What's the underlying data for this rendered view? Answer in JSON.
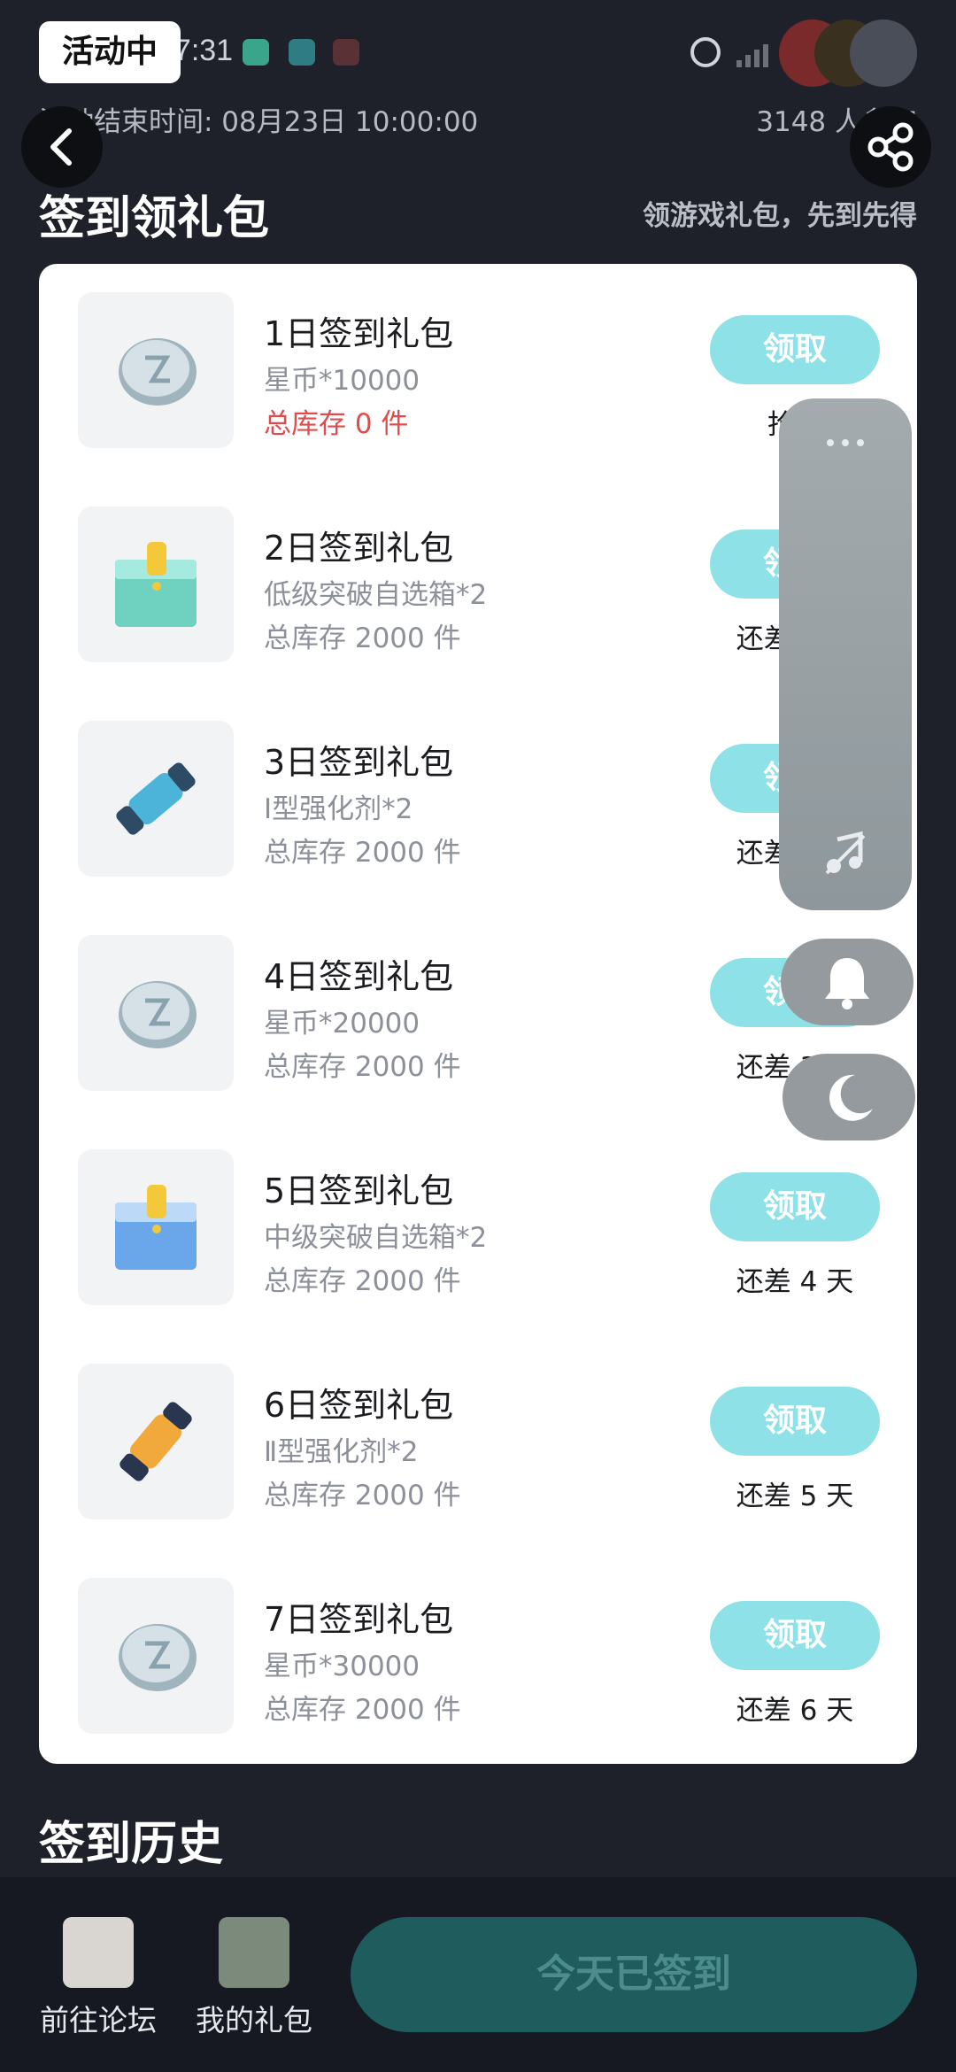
{
  "status_bar": {
    "time": "17:31"
  },
  "header": {
    "badge": "活动中",
    "end_time": "活动结束时间: 08月23日 10:00:00",
    "participants": "3148 人参加"
  },
  "signin_section": {
    "title": "签到领礼包",
    "subtitle": "领游戏礼包，先到先得"
  },
  "gifts": [
    {
      "title": "1日签到礼包",
      "desc": "星币*10000",
      "stock": "总库存 0 件",
      "button": "领取",
      "note": "抢光",
      "icon": "silver-coin-icon"
    },
    {
      "title": "2日签到礼包",
      "desc": "低级突破自选箱*2",
      "stock": "总库存 2000 件",
      "button": "领取",
      "note": "还差 1 天",
      "icon": "green-mystery-box-icon"
    },
    {
      "title": "3日签到礼包",
      "desc": "Ⅰ型强化剂*2",
      "stock": "总库存 2000 件",
      "button": "领取",
      "note": "还差 2 天",
      "icon": "blue-capsule-icon"
    },
    {
      "title": "4日签到礼包",
      "desc": "星币*20000",
      "stock": "总库存 2000 件",
      "button": "领取",
      "note": "还差 3 天",
      "icon": "silver-coin-icon"
    },
    {
      "title": "5日签到礼包",
      "desc": "中级突破自选箱*2",
      "stock": "总库存 2000 件",
      "button": "领取",
      "note": "还差 4 天",
      "icon": "blue-mystery-box-icon"
    },
    {
      "title": "6日签到礼包",
      "desc": "Ⅱ型强化剂*2",
      "stock": "总库存 2000 件",
      "button": "领取",
      "note": "还差 5 天",
      "icon": "orange-capsule-icon"
    },
    {
      "title": "7日签到礼包",
      "desc": "星币*30000",
      "stock": "总库存 2000 件",
      "button": "领取",
      "note": "还差 6 天",
      "icon": "silver-coin-icon"
    }
  ],
  "history_section": {
    "title": "签到历史"
  },
  "bottom_nav": {
    "forum_label": "前往论坛",
    "gifts_label": "我的礼包",
    "checkin_button": "今天已签到"
  },
  "colors": {
    "background": "#1e2129",
    "card": "#ffffff",
    "claim_button": "#8fe1e8",
    "checkin_button": "#1f5c5e",
    "stock_empty": "#e24b4b"
  }
}
